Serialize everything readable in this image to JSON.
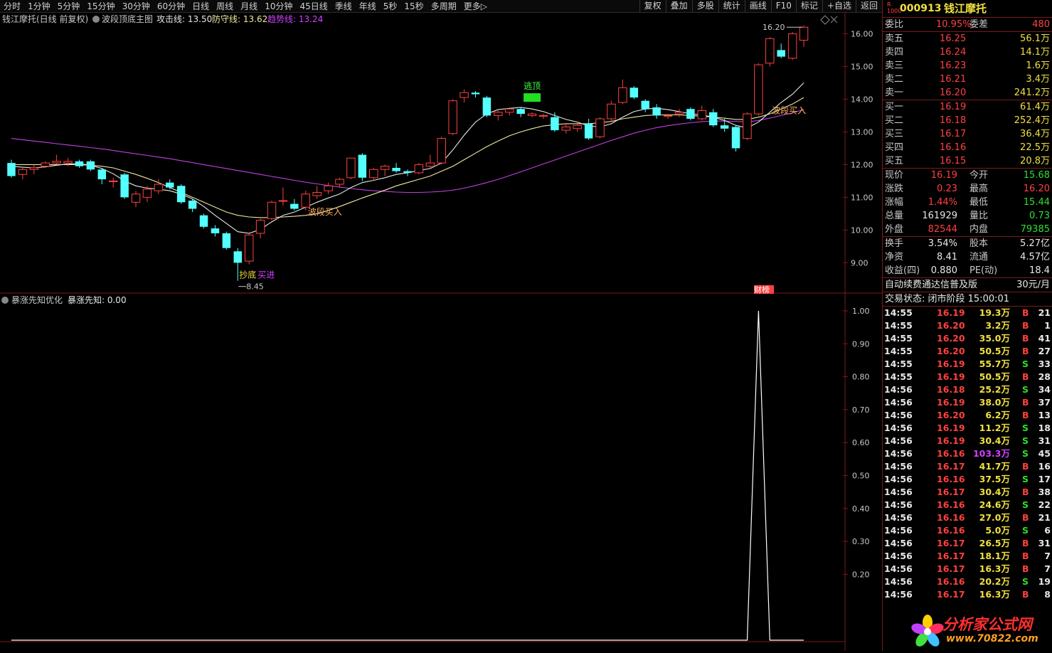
{
  "toolbar": {
    "periods": [
      "分时",
      "1分钟",
      "5分钟",
      "15分钟",
      "30分钟",
      "60分钟",
      "日线",
      "周线",
      "月线",
      "10分钟",
      "45日线",
      "季线",
      "年线",
      "5秒",
      "15秒",
      "多周期",
      "更多▷"
    ],
    "buttons": [
      "复权",
      "叠加",
      "多股",
      "统计",
      "画线",
      "F10",
      "标记",
      "+自选",
      "返回"
    ]
  },
  "main_chart": {
    "stock_label": "钱江摩托(日线 前复权)",
    "indicator_name": "波段顶底主图",
    "attack_label": "攻击线: 13.50",
    "defense_label": "防守线: 13.62",
    "trend_label": "趋势线: 13.24",
    "high_label": "16.20",
    "low_label": "8.45",
    "signal_top": "逃顶",
    "signal_buy1": "波段买入",
    "signal_buy2": "波段买入",
    "signal_bottom": "抄底",
    "signal_buyin": "买进",
    "caibang": "财榜"
  },
  "sub_chart": {
    "indicator_name": "暴涨先知优化",
    "value_label": "暴涨先知: 0.00"
  },
  "chart_data": [
    {
      "type": "candlestick",
      "y_ticks": [
        "16.00",
        "15.00",
        "14.00",
        "13.00",
        "12.00",
        "11.00",
        "10.00",
        "9.00"
      ],
      "ylim": [
        8.4,
        16.4
      ],
      "candles": [
        [
          12.05,
          12.15,
          11.6,
          11.65
        ],
        [
          11.7,
          11.9,
          11.55,
          11.85
        ],
        [
          11.85,
          12.0,
          11.7,
          11.9
        ],
        [
          11.95,
          12.1,
          11.9,
          12.05
        ],
        [
          12.05,
          12.3,
          12.0,
          12.1
        ],
        [
          12.05,
          12.2,
          11.95,
          12.1
        ],
        [
          12.1,
          12.15,
          11.9,
          11.95
        ],
        [
          12.1,
          12.15,
          11.8,
          11.85
        ],
        [
          11.85,
          11.9,
          11.4,
          11.55
        ],
        [
          11.5,
          11.6,
          11.3,
          11.5
        ],
        [
          11.7,
          11.75,
          10.95,
          11.0
        ],
        [
          10.85,
          11.2,
          10.7,
          11.1
        ],
        [
          11.0,
          11.35,
          10.85,
          11.25
        ],
        [
          11.2,
          11.55,
          11.1,
          11.4
        ],
        [
          11.45,
          11.55,
          11.25,
          11.3
        ],
        [
          11.35,
          11.4,
          10.8,
          10.85
        ],
        [
          10.9,
          10.95,
          10.55,
          10.65
        ],
        [
          10.45,
          10.5,
          10.05,
          10.1
        ],
        [
          10.05,
          10.15,
          9.8,
          9.9
        ],
        [
          9.9,
          9.95,
          9.4,
          9.45
        ],
        [
          9.35,
          9.45,
          8.45,
          9.0
        ],
        [
          9.05,
          9.9,
          8.95,
          9.85
        ],
        [
          9.9,
          10.35,
          9.75,
          10.3
        ],
        [
          10.35,
          10.9,
          10.3,
          10.85
        ],
        [
          10.9,
          11.3,
          10.75,
          10.9
        ],
        [
          10.8,
          10.95,
          10.6,
          10.65
        ],
        [
          10.7,
          11.2,
          10.6,
          11.1
        ],
        [
          11.05,
          11.35,
          10.95,
          11.15
        ],
        [
          11.2,
          11.45,
          11.1,
          11.35
        ],
        [
          11.4,
          11.6,
          11.3,
          11.55
        ],
        [
          11.6,
          12.2,
          11.55,
          12.2
        ],
        [
          12.3,
          12.35,
          11.5,
          11.6
        ],
        [
          11.6,
          11.9,
          11.5,
          11.85
        ],
        [
          11.85,
          12.0,
          11.65,
          11.95
        ],
        [
          11.9,
          12.05,
          11.75,
          11.8
        ],
        [
          11.8,
          11.85,
          11.65,
          11.75
        ],
        [
          11.75,
          12.05,
          11.7,
          12.0
        ],
        [
          11.95,
          12.3,
          11.9,
          12.05
        ],
        [
          12.05,
          12.85,
          12.0,
          12.8
        ],
        [
          12.95,
          14.0,
          12.9,
          13.95
        ],
        [
          14.05,
          14.3,
          13.9,
          14.2
        ],
        [
          14.2,
          14.25,
          14.05,
          14.15
        ],
        [
          14.05,
          14.1,
          13.45,
          13.5
        ],
        [
          13.5,
          13.65,
          13.35,
          13.6
        ],
        [
          13.6,
          13.75,
          13.5,
          13.7
        ],
        [
          13.7,
          13.75,
          13.45,
          13.55
        ],
        [
          13.5,
          13.6,
          13.45,
          13.55
        ],
        [
          13.5,
          13.55,
          13.4,
          13.5
        ],
        [
          13.45,
          13.6,
          13.0,
          13.05
        ],
        [
          13.05,
          13.25,
          12.95,
          13.15
        ],
        [
          13.1,
          13.3,
          13.0,
          13.2
        ],
        [
          13.25,
          13.4,
          12.75,
          12.8
        ],
        [
          12.85,
          13.45,
          12.8,
          13.4
        ],
        [
          13.4,
          13.95,
          13.3,
          13.85
        ],
        [
          13.9,
          14.6,
          13.85,
          14.35
        ],
        [
          14.35,
          14.4,
          14.0,
          14.05
        ],
        [
          13.95,
          14.0,
          13.6,
          13.7
        ],
        [
          13.75,
          13.85,
          13.4,
          13.5
        ],
        [
          13.5,
          13.55,
          13.4,
          13.5
        ],
        [
          13.55,
          13.7,
          13.45,
          13.6
        ],
        [
          13.7,
          13.75,
          13.35,
          13.4
        ],
        [
          13.4,
          13.8,
          13.35,
          13.65
        ],
        [
          13.6,
          13.7,
          13.15,
          13.2
        ],
        [
          13.2,
          13.4,
          13.0,
          13.1
        ],
        [
          13.15,
          13.2,
          12.4,
          12.5
        ],
        [
          12.8,
          13.6,
          12.75,
          13.55
        ],
        [
          13.55,
          15.1,
          13.5,
          15.05
        ],
        [
          15.1,
          15.9,
          15.0,
          15.85
        ],
        [
          15.5,
          15.7,
          15.25,
          15.3
        ],
        [
          15.25,
          16.05,
          15.2,
          16.0
        ],
        [
          15.8,
          16.25,
          15.6,
          16.2
        ]
      ],
      "ma_fast": [
        11.95,
        11.92,
        11.9,
        11.93,
        11.98,
        12.02,
        12.03,
        11.98,
        11.88,
        11.72,
        11.5,
        11.35,
        11.28,
        11.25,
        11.2,
        11.1,
        10.95,
        10.72,
        10.45,
        10.2,
        9.95,
        9.9,
        10.02,
        10.25,
        10.45,
        10.55,
        10.7,
        10.85,
        10.98,
        11.1,
        11.3,
        11.45,
        11.52,
        11.6,
        11.7,
        11.75,
        11.82,
        11.88,
        12.05,
        12.45,
        12.9,
        13.3,
        13.55,
        13.68,
        13.72,
        13.75,
        13.7,
        13.62,
        13.5,
        13.38,
        13.3,
        13.18,
        13.15,
        13.25,
        13.45,
        13.62,
        13.7,
        13.72,
        13.68,
        13.62,
        13.55,
        13.52,
        13.45,
        13.35,
        13.2,
        13.12,
        13.3,
        13.6,
        13.9,
        14.15,
        14.5
      ],
      "ma_slow": [
        12.0,
        12.0,
        12.0,
        12.0,
        12.0,
        12.0,
        12.0,
        11.98,
        11.95,
        11.9,
        11.8,
        11.7,
        11.58,
        11.45,
        11.3,
        11.15,
        11.0,
        10.85,
        10.7,
        10.55,
        10.45,
        10.4,
        10.38,
        10.38,
        10.4,
        10.42,
        10.45,
        10.5,
        10.6,
        10.72,
        10.85,
        10.98,
        11.1,
        11.22,
        11.35,
        11.45,
        11.55,
        11.65,
        11.8,
        11.95,
        12.15,
        12.35,
        12.55,
        12.72,
        12.88,
        13.0,
        13.1,
        13.18,
        13.22,
        13.25,
        13.25,
        13.25,
        13.28,
        13.32,
        13.4,
        13.45,
        13.5,
        13.52,
        13.52,
        13.52,
        13.5,
        13.48,
        13.45,
        13.42,
        13.38,
        13.38,
        13.45,
        13.55,
        13.7,
        13.85,
        14.05
      ],
      "ma_trend": [
        12.8,
        12.76,
        12.72,
        12.68,
        12.64,
        12.6,
        12.56,
        12.52,
        12.48,
        12.43,
        12.38,
        12.33,
        12.28,
        12.23,
        12.18,
        12.12,
        12.06,
        12.0,
        11.94,
        11.88,
        11.82,
        11.76,
        11.7,
        11.64,
        11.58,
        11.52,
        11.46,
        11.41,
        11.36,
        11.31,
        11.27,
        11.23,
        11.2,
        11.18,
        11.16,
        11.15,
        11.15,
        11.16,
        11.18,
        11.22,
        11.28,
        11.36,
        11.45,
        11.55,
        11.66,
        11.78,
        11.9,
        12.02,
        12.14,
        12.26,
        12.38,
        12.5,
        12.62,
        12.74,
        12.85,
        12.96,
        13.05,
        13.13,
        13.19,
        13.24,
        13.28,
        13.31,
        13.33,
        13.33,
        13.32,
        13.3,
        13.35,
        13.42,
        13.5,
        13.58,
        13.68
      ]
    },
    {
      "type": "line",
      "y_ticks": [
        "1.00",
        "0.90",
        "0.80",
        "0.70",
        "0.60",
        "0.50",
        "0.40",
        "0.30",
        "0.20"
      ],
      "ylim": [
        0,
        1.0
      ],
      "values": [
        0,
        0,
        0,
        0,
        0,
        0,
        0,
        0,
        0,
        0,
        0,
        0,
        0,
        0,
        0,
        0,
        0,
        0,
        0,
        0,
        0,
        0,
        0,
        0,
        0,
        0,
        0,
        0,
        0,
        0,
        0,
        0,
        0,
        0,
        0,
        0,
        0,
        0,
        0,
        0,
        0,
        0,
        0,
        0,
        0,
        0,
        0,
        0,
        0,
        0,
        0,
        0,
        0,
        0,
        0,
        0,
        0,
        0,
        0,
        0,
        0,
        0,
        0,
        0,
        0,
        0,
        1.0,
        0,
        0,
        0,
        0
      ]
    }
  ],
  "side": {
    "code": "000913",
    "name": "钱江摩托",
    "weibi_label": "委比",
    "weibi_value": "10.95%",
    "weicha_label": "委差",
    "weicha_value": "480",
    "asks": [
      {
        "label": "卖五",
        "price": "16.25",
        "vol": "56.1万"
      },
      {
        "label": "卖四",
        "price": "16.24",
        "vol": "14.1万"
      },
      {
        "label": "卖三",
        "price": "16.23",
        "vol": "1.6万"
      },
      {
        "label": "卖二",
        "price": "16.21",
        "vol": "3.4万"
      },
      {
        "label": "卖一",
        "price": "16.20",
        "vol": "241.2万"
      }
    ],
    "bids": [
      {
        "label": "买一",
        "price": "16.19",
        "vol": "61.4万"
      },
      {
        "label": "买二",
        "price": "16.18",
        "vol": "252.4万"
      },
      {
        "label": "买三",
        "price": "16.17",
        "vol": "36.4万"
      },
      {
        "label": "买四",
        "price": "16.16",
        "vol": "22.5万"
      },
      {
        "label": "买五",
        "price": "16.15",
        "vol": "20.8万"
      }
    ],
    "stats": [
      {
        "l1": "现价",
        "v1": "16.19",
        "c1": "red",
        "l2": "今开",
        "v2": "15.68",
        "c2": "green"
      },
      {
        "l1": "涨跌",
        "v1": "0.23",
        "c1": "red",
        "l2": "最高",
        "v2": "16.20",
        "c2": "red"
      },
      {
        "l1": "涨幅",
        "v1": "1.44%",
        "c1": "red",
        "l2": "最低",
        "v2": "15.44",
        "c2": "green"
      },
      {
        "l1": "总量",
        "v1": "161929",
        "c1": "white",
        "l2": "量比",
        "v2": "0.73",
        "c2": "green"
      },
      {
        "l1": "外盘",
        "v1": "82544",
        "c1": "red",
        "l2": "内盘",
        "v2": "79385",
        "c2": "green"
      }
    ],
    "stats2": [
      {
        "l1": "换手",
        "v1": "3.54%",
        "l2": "股本",
        "v2": "5.27亿"
      },
      {
        "l1": "净资",
        "v1": "8.41",
        "l2": "流通",
        "v2": "4.57亿"
      },
      {
        "l1": "收益(四)",
        "v1": "0.880",
        "l2": "PE(动)",
        "v2": "18.4"
      }
    ],
    "promo": "自动续费通达信普及版",
    "promo_price": "30元/月",
    "trade_status": "交易状态: 闭市阶段 15:00:01",
    "ticks": [
      {
        "t": "14:55",
        "p": "16.19",
        "pc": "red",
        "v": "19.3万",
        "vc": "yellow",
        "bs": "B",
        "n": "21"
      },
      {
        "t": "14:55",
        "p": "16.20",
        "pc": "red",
        "v": "3.2万",
        "vc": "yellow",
        "bs": "B",
        "n": "1"
      },
      {
        "t": "14:55",
        "p": "16.20",
        "pc": "red",
        "v": "35.0万",
        "vc": "yellow",
        "bs": "B",
        "n": "41"
      },
      {
        "t": "14:55",
        "p": "16.20",
        "pc": "red",
        "v": "50.5万",
        "vc": "yellow",
        "bs": "B",
        "n": "27"
      },
      {
        "t": "14:55",
        "p": "16.19",
        "pc": "red",
        "v": "55.7万",
        "vc": "yellow",
        "bs": "S",
        "n": "33"
      },
      {
        "t": "14:55",
        "p": "16.19",
        "pc": "red",
        "v": "50.5万",
        "vc": "yellow",
        "bs": "B",
        "n": "28"
      },
      {
        "t": "14:56",
        "p": "16.18",
        "pc": "red",
        "v": "25.2万",
        "vc": "yellow",
        "bs": "S",
        "n": "34"
      },
      {
        "t": "14:56",
        "p": "16.19",
        "pc": "red",
        "v": "38.0万",
        "vc": "yellow",
        "bs": "B",
        "n": "37"
      },
      {
        "t": "14:56",
        "p": "16.20",
        "pc": "red",
        "v": "6.2万",
        "vc": "yellow",
        "bs": "B",
        "n": "13"
      },
      {
        "t": "14:56",
        "p": "16.19",
        "pc": "red",
        "v": "11.2万",
        "vc": "yellow",
        "bs": "S",
        "n": "18"
      },
      {
        "t": "14:56",
        "p": "16.19",
        "pc": "red",
        "v": "30.4万",
        "vc": "yellow",
        "bs": "S",
        "n": "31"
      },
      {
        "t": "14:56",
        "p": "16.16",
        "pc": "red",
        "v": "103.3万",
        "vc": "purple",
        "bs": "S",
        "n": "45"
      },
      {
        "t": "14:56",
        "p": "16.17",
        "pc": "red",
        "v": "41.7万",
        "vc": "yellow",
        "bs": "B",
        "n": "16"
      },
      {
        "t": "14:56",
        "p": "16.16",
        "pc": "red",
        "v": "37.5万",
        "vc": "yellow",
        "bs": "S",
        "n": "17"
      },
      {
        "t": "14:56",
        "p": "16.17",
        "pc": "red",
        "v": "30.4万",
        "vc": "yellow",
        "bs": "B",
        "n": "38"
      },
      {
        "t": "14:56",
        "p": "16.16",
        "pc": "red",
        "v": "24.6万",
        "vc": "yellow",
        "bs": "S",
        "n": "22"
      },
      {
        "t": "14:56",
        "p": "16.16",
        "pc": "red",
        "v": "27.0万",
        "vc": "yellow",
        "bs": "B",
        "n": "21"
      },
      {
        "t": "14:56",
        "p": "16.16",
        "pc": "red",
        "v": "5.0万",
        "vc": "yellow",
        "bs": "S",
        "n": "6"
      },
      {
        "t": "14:56",
        "p": "16.17",
        "pc": "red",
        "v": "26.5万",
        "vc": "yellow",
        "bs": "B",
        "n": "31"
      },
      {
        "t": "14:56",
        "p": "16.17",
        "pc": "red",
        "v": "18.1万",
        "vc": "yellow",
        "bs": "B",
        "n": "7"
      },
      {
        "t": "14:56",
        "p": "16.17",
        "pc": "red",
        "v": "16.3万",
        "vc": "yellow",
        "bs": "B",
        "n": "7"
      },
      {
        "t": "14:56",
        "p": "16.16",
        "pc": "red",
        "v": "20.2万",
        "vc": "yellow",
        "bs": "S",
        "n": "19"
      },
      {
        "t": "14:56",
        "p": "16.17",
        "pc": "red",
        "v": "16.3万",
        "vc": "yellow",
        "bs": "B",
        "n": "8"
      }
    ],
    "logo_text": "分析家公式网",
    "logo_url": "www.70822.com"
  },
  "colors": {
    "up": "#ff4040",
    "down": "#54ffff",
    "fast": "#e8e8e8",
    "slow": "#f0e8a0",
    "trend": "#c040e0",
    "border": "#7a1a1a"
  }
}
